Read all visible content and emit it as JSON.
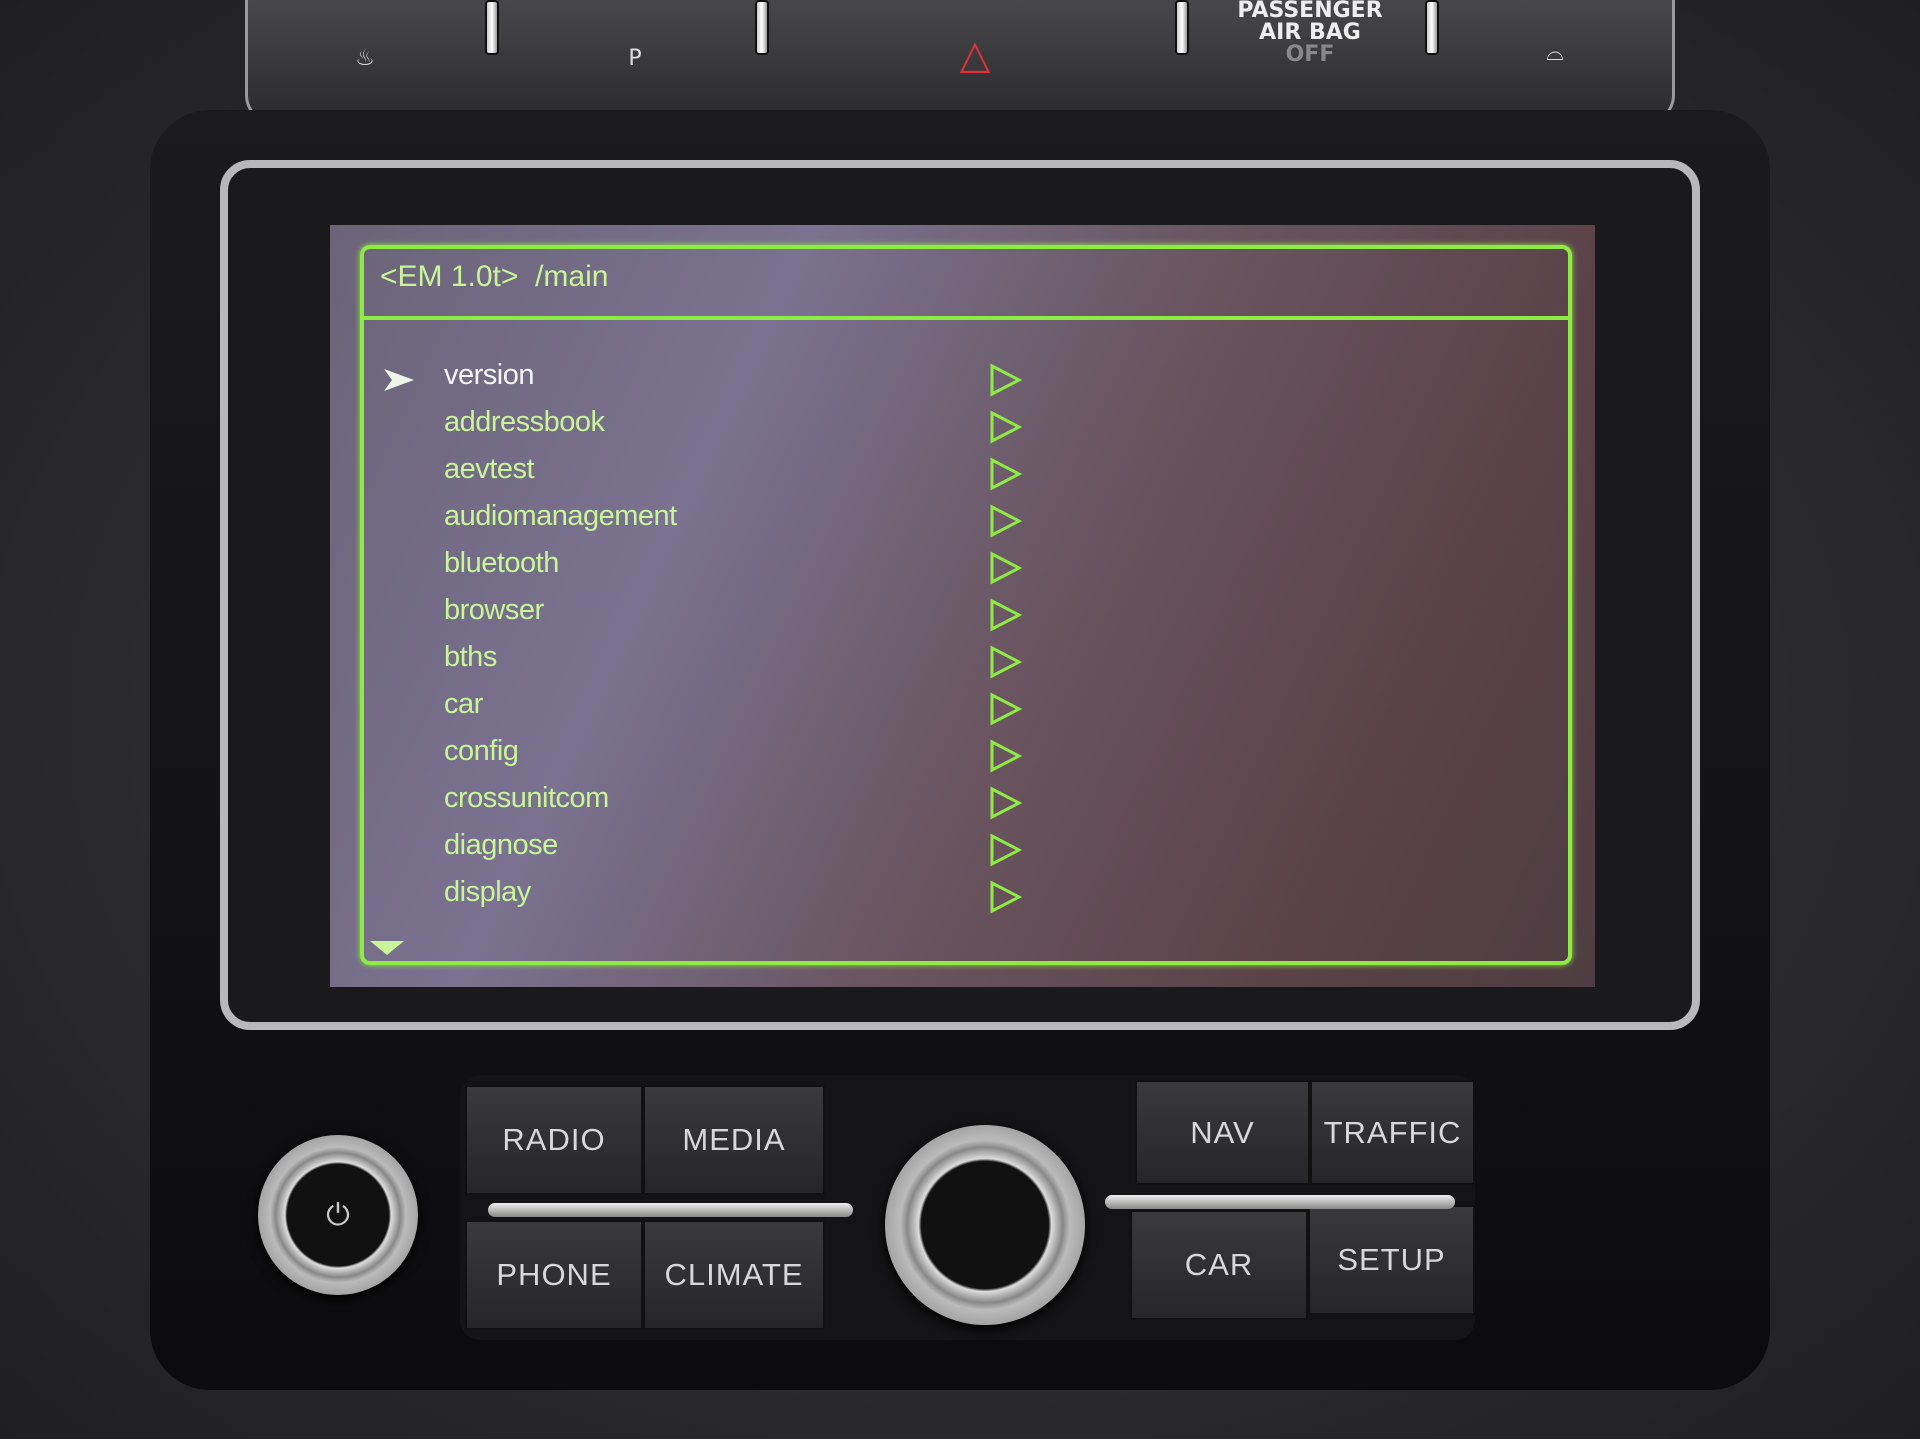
{
  "top_buttons": {
    "park_assist": "P",
    "passenger_airbag": "PASSENGER AIR BAG",
    "airbag_status": "OFF"
  },
  "screen": {
    "header": "<EM 1.0t>  /main",
    "selected_index": 0,
    "items": [
      "version",
      "addressbook",
      "aevtest",
      "audiomanagement",
      "bluetooth",
      "browser",
      "bths",
      "car",
      "config",
      "crossunitcom",
      "diagnose",
      "display"
    ],
    "accent_color": "#8eea45"
  },
  "buttons": {
    "radio": "RADIO",
    "media": "MEDIA",
    "nav": "NAV",
    "traffic": "TRAFFIC",
    "phone": "PHONE",
    "climate": "CLIMATE",
    "car": "CAR",
    "setup": "SETUP"
  }
}
